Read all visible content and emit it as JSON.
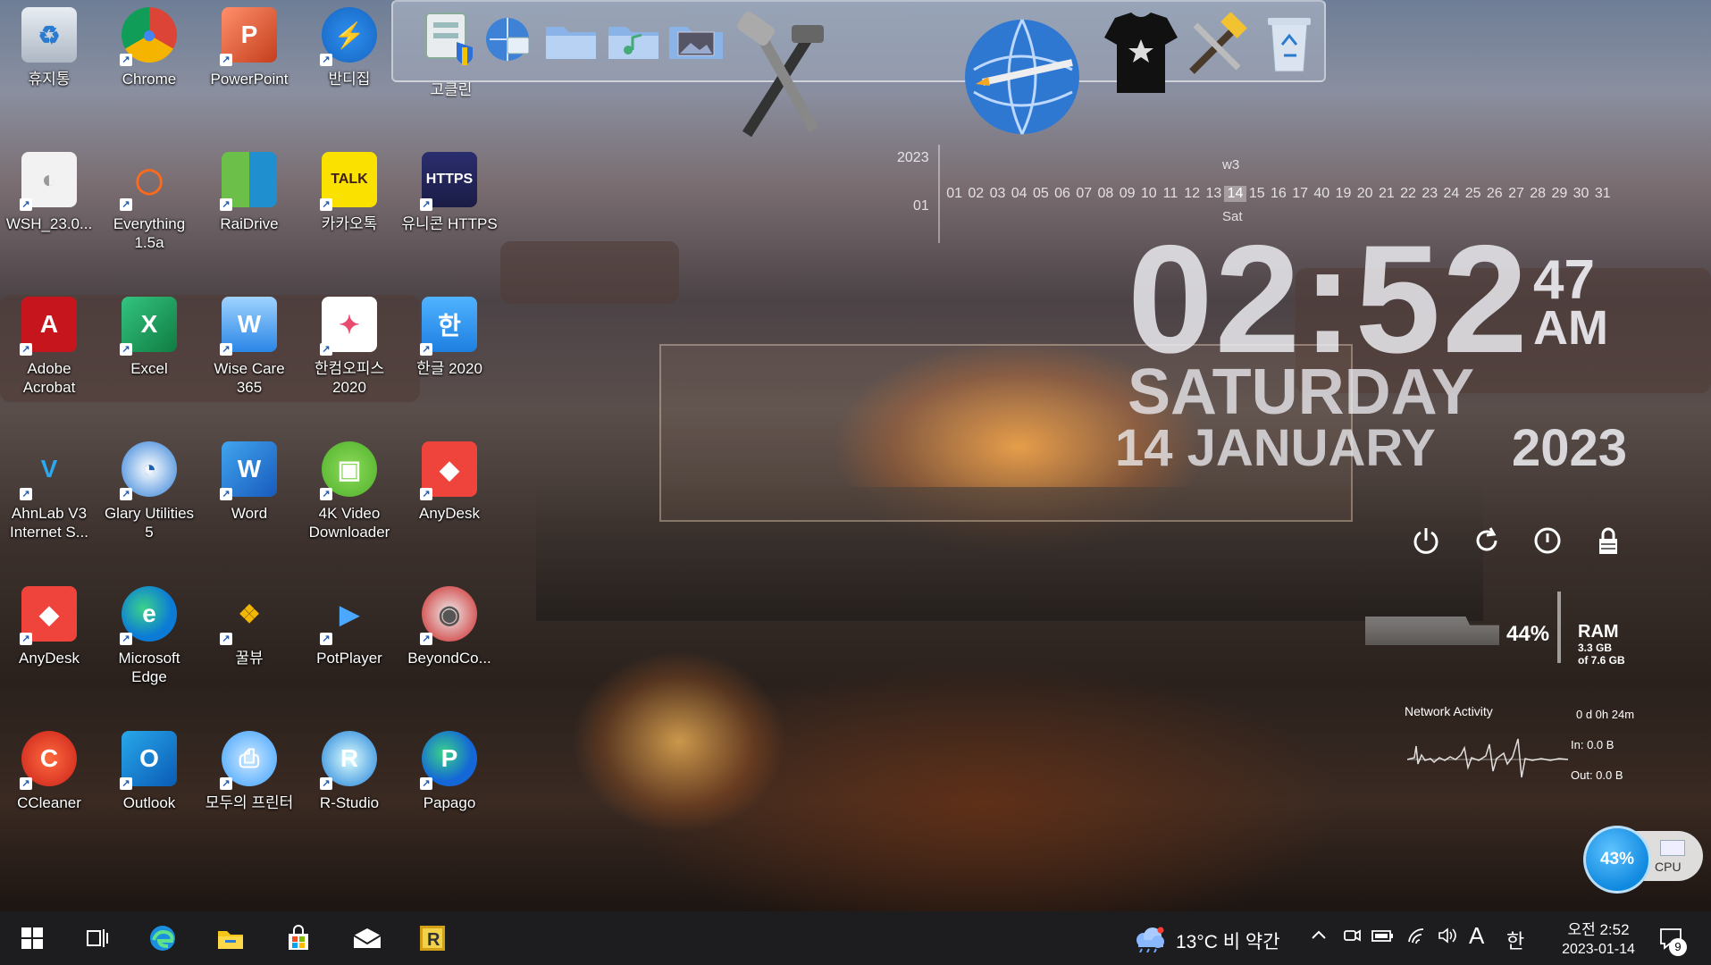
{
  "desktop": {
    "icons": [
      {
        "label": "휴지통",
        "icon": "recycle-bin-icon"
      },
      {
        "label": "Chrome",
        "icon": "chrome-icon"
      },
      {
        "label": "PowerPoint",
        "icon": "powerpoint-icon"
      },
      {
        "label": "반디집",
        "icon": "bandizip-icon"
      },
      {
        "label": "WSH_23.0...",
        "icon": "document-icon"
      },
      {
        "label": "Everything 1.5a",
        "icon": "everything-search-icon"
      },
      {
        "label": "RaiDrive",
        "icon": "raidrive-icon"
      },
      {
        "label": "카카오톡",
        "icon": "kakaotalk-icon"
      },
      {
        "label": "유니콘 HTTPS",
        "icon": "unicorn-https-icon"
      },
      {
        "label": "Adobe Acrobat",
        "icon": "acrobat-icon"
      },
      {
        "label": "Excel",
        "icon": "excel-icon"
      },
      {
        "label": "Wise Care 365",
        "icon": "wise-care-icon"
      },
      {
        "label": "한컴오피스 2020",
        "icon": "hancom-office-icon"
      },
      {
        "label": "한글 2020",
        "icon": "hangul-icon"
      },
      {
        "label": "AhnLab V3 Internet S...",
        "icon": "ahnlab-v3-icon"
      },
      {
        "label": "Glary Utilities 5",
        "icon": "glary-utilities-icon"
      },
      {
        "label": "Word",
        "icon": "word-icon"
      },
      {
        "label": "4K Video Downloader",
        "icon": "4k-video-downloader-icon"
      },
      {
        "label": "AnyDesk",
        "icon": "anydesk-icon"
      },
      {
        "label": "AnyDesk",
        "icon": "anydesk-icon"
      },
      {
        "label": "Microsoft Edge",
        "icon": "edge-icon"
      },
      {
        "label": "꿀뷰",
        "icon": "honeyview-icon"
      },
      {
        "label": "PotPlayer",
        "icon": "potplayer-icon"
      },
      {
        "label": "BeyondCo...",
        "icon": "beyond-compare-icon"
      },
      {
        "label": "CCleaner",
        "icon": "ccleaner-icon"
      },
      {
        "label": "Outlook",
        "icon": "outlook-icon"
      },
      {
        "label": "모두의 프린터",
        "icon": "printer-icon"
      },
      {
        "label": "R-Studio",
        "icon": "r-studio-icon"
      },
      {
        "label": "Papago",
        "icon": "papago-icon"
      }
    ]
  },
  "dock": {
    "label": "고클린"
  },
  "calendar": {
    "year": "2023",
    "month": "01",
    "week": "w3",
    "weekday_short": "Sat",
    "days": [
      "01",
      "02",
      "03",
      "04",
      "05",
      "06",
      "07",
      "08",
      "09",
      "10",
      "11",
      "12",
      "13",
      "14",
      "15",
      "16",
      "17",
      "40",
      "19",
      "20",
      "21",
      "22",
      "23",
      "24",
      "25",
      "26",
      "27",
      "28",
      "29",
      "30",
      "31"
    ],
    "today_index": 13
  },
  "clock": {
    "time": "02:52",
    "seconds": "47",
    "ampm": "AM",
    "day": "SATURDAY",
    "date": "14 JANUARY",
    "year": "2023"
  },
  "ram": {
    "percent": "44%",
    "label": "RAM",
    "used": "3.3 GB",
    "total": "of 7.6 GB",
    "level": 0.44
  },
  "network": {
    "title": "Network Activity",
    "uptime": "0 d 0h 24m",
    "in": "In: 0.0 B",
    "out": "Out: 0.0 B"
  },
  "cpu": {
    "percent": "43%",
    "label": "CPU"
  },
  "taskbar": {
    "weather": "13°C  비 약간",
    "ime": "한",
    "font_indicator": "A",
    "time": "오전 2:52",
    "date": "2023-01-14",
    "notifications": "9"
  },
  "colors": {
    "taskbar": "#1d1c1e",
    "cpu_blue": "#1089e0"
  }
}
